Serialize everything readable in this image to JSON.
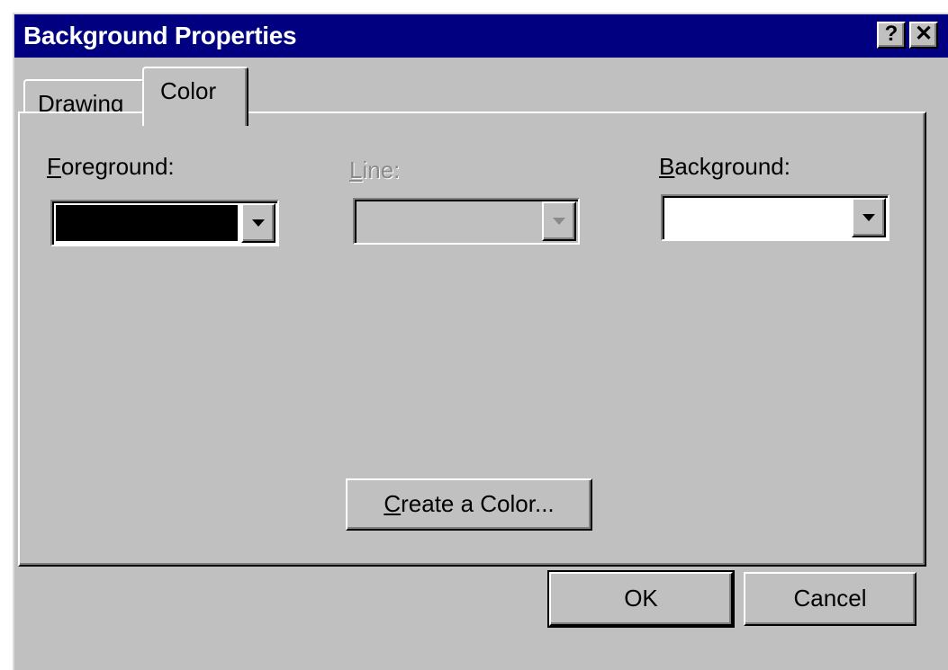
{
  "window": {
    "title": "Background Properties",
    "help_label": "?",
    "close_label": "✕"
  },
  "tabs": [
    {
      "label": "Drawing",
      "active": false
    },
    {
      "label": "Color",
      "active": true
    }
  ],
  "color_tab": {
    "foreground": {
      "label_first": "F",
      "label_rest": "oreground:",
      "value_color": "#000000",
      "enabled": true
    },
    "line": {
      "label_first": "L",
      "label_rest": "ine:",
      "value_color": "#c0c0c0",
      "enabled": false
    },
    "background": {
      "label_first": "B",
      "label_rest": "ackground:",
      "value_color": "#ffffff",
      "enabled": true
    },
    "create_color": {
      "label_first": "C",
      "label_rest": "reate a Color..."
    }
  },
  "footer": {
    "ok_label": "OK",
    "cancel_label": "Cancel"
  },
  "colors": {
    "titlebar": "#000080",
    "face": "#c0c0c0"
  }
}
